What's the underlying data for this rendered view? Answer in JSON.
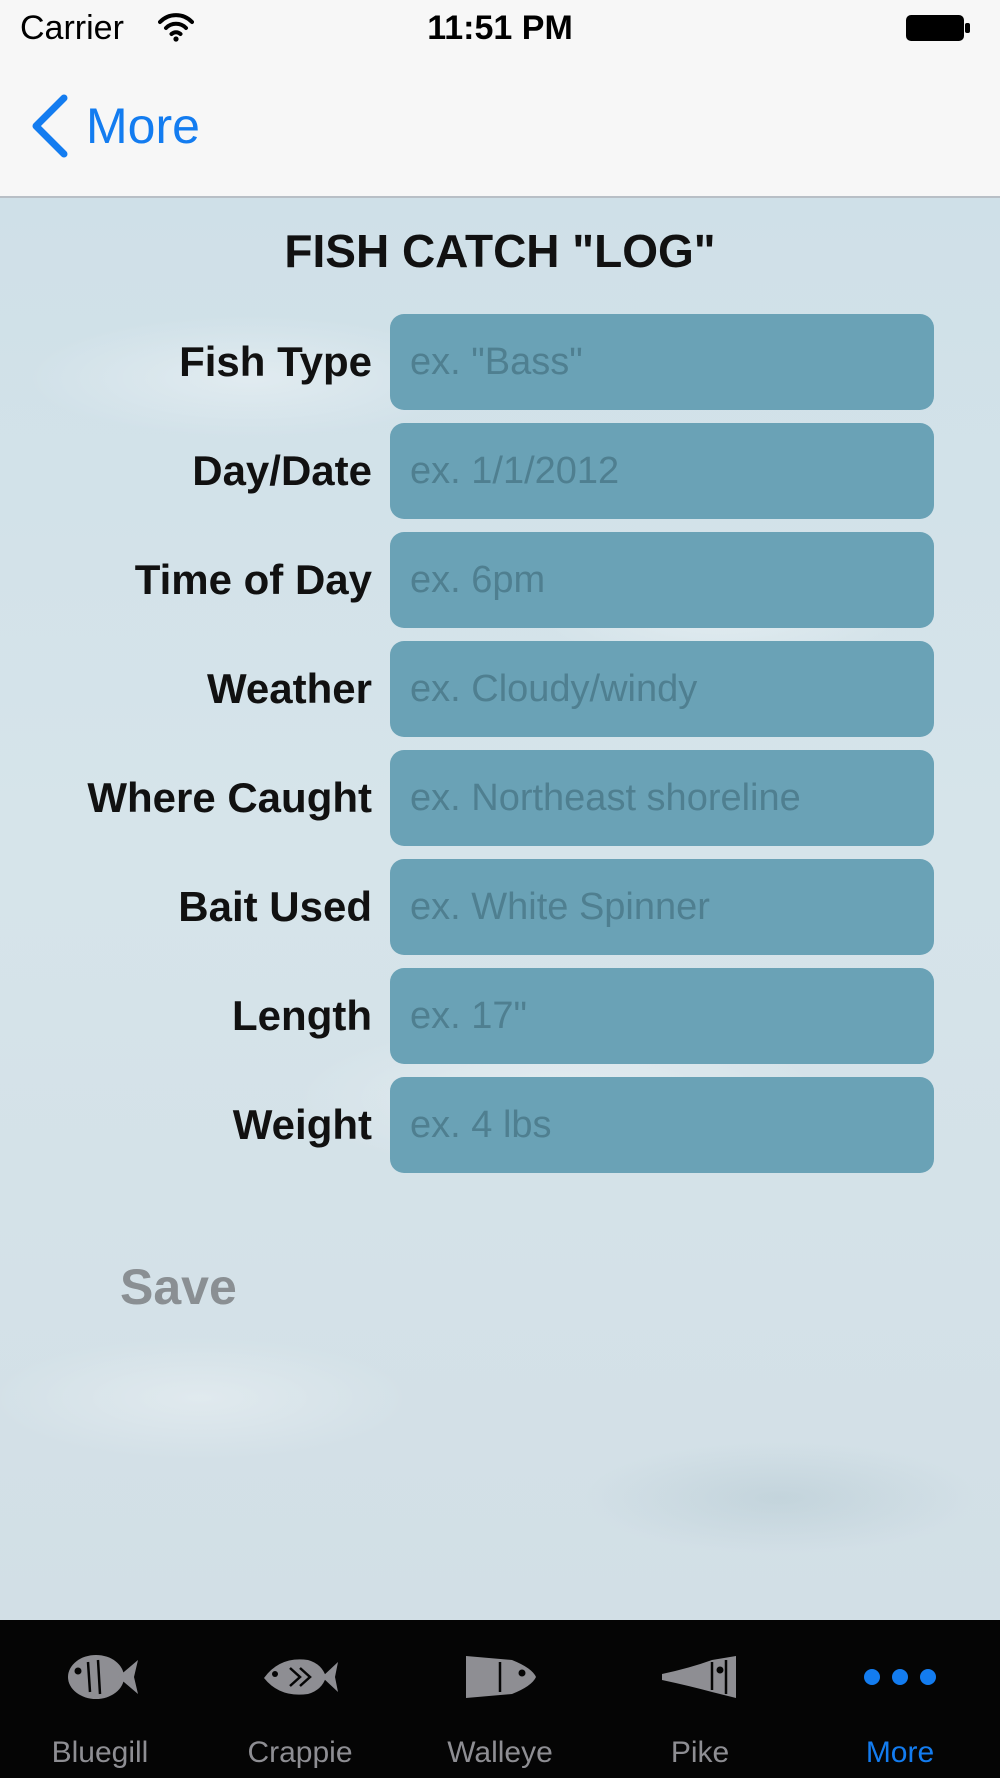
{
  "status_bar": {
    "carrier": "Carrier",
    "time": "11:51 PM"
  },
  "nav": {
    "back_label": "More"
  },
  "page": {
    "title": "FISH CATCH \"LOG\""
  },
  "form": {
    "fields": [
      {
        "label": "Fish Type",
        "placeholder": "ex. \"Bass\"",
        "value": ""
      },
      {
        "label": "Day/Date",
        "placeholder": "ex. 1/1/2012",
        "value": ""
      },
      {
        "label": "Time of Day",
        "placeholder": "ex. 6pm",
        "value": ""
      },
      {
        "label": "Weather",
        "placeholder": "ex. Cloudy/windy",
        "value": ""
      },
      {
        "label": "Where Caught",
        "placeholder": "ex. Northeast shoreline",
        "value": ""
      },
      {
        "label": "Bait Used",
        "placeholder": "ex. White Spinner",
        "value": ""
      },
      {
        "label": "Length",
        "placeholder": "ex. 17\"",
        "value": ""
      },
      {
        "label": "Weight",
        "placeholder": "ex. 4 lbs",
        "value": ""
      }
    ],
    "save_label": "Save"
  },
  "tab_bar": {
    "items": [
      {
        "label": "Bluegill",
        "icon": "bluegill-icon",
        "active": false
      },
      {
        "label": "Crappie",
        "icon": "crappie-icon",
        "active": false
      },
      {
        "label": "Walleye",
        "icon": "walleye-icon",
        "active": false
      },
      {
        "label": "Pike",
        "icon": "pike-icon",
        "active": false
      },
      {
        "label": "More",
        "icon": "more-icon",
        "active": true
      }
    ]
  },
  "colors": {
    "accent": "#137cf0",
    "input_fill": "#6aa2b6",
    "tab_bar_bg": "#050505",
    "tab_inactive": "#8e8e93",
    "save_text": "#8a8f93"
  }
}
